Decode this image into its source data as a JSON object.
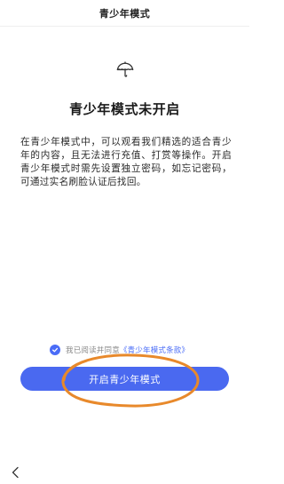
{
  "header": {
    "title": "青少年模式"
  },
  "hero": {
    "icon": "umbrella-icon",
    "title": "青少年模式未开启"
  },
  "description": "在青少年模式中，可以观看我们精选的适合青少年的内容，且无法进行充值、打赏等操作。开启青少年模式时需先设置独立密码，如忘记密码，可通过实名刷脸认证后找回。",
  "agreement": {
    "checked": true,
    "prefix": "我已阅读并同意",
    "link": "《青少年模式条款》"
  },
  "actions": {
    "enable_label": "开启青少年模式"
  },
  "nav": {
    "back_icon": "chevron-left-icon"
  },
  "colors": {
    "accent": "#4a69f0",
    "annotation": "#e8892b"
  }
}
